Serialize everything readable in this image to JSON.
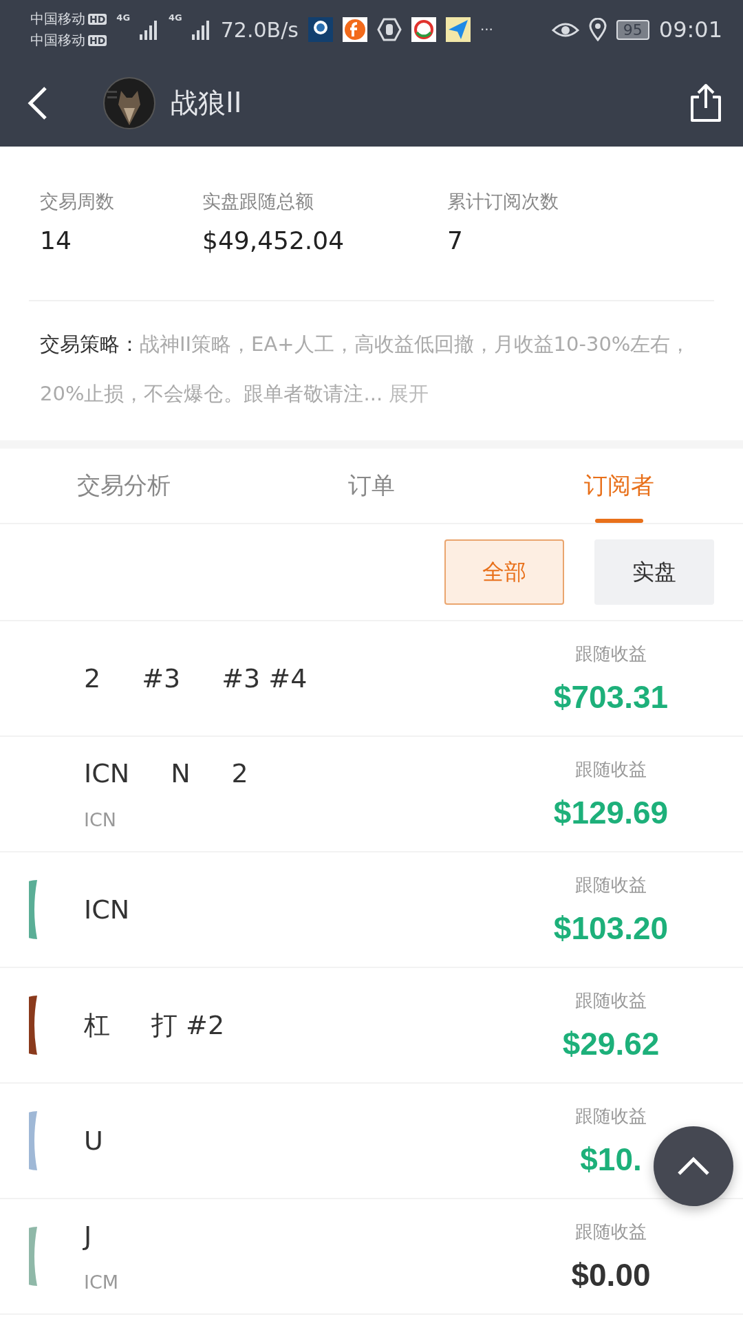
{
  "status_bar": {
    "carrier_1": "中国移动",
    "carrier_2": "中国移动",
    "hd_1": "HD",
    "hd_2": "HD",
    "net_1": "4G",
    "net_2": "4G",
    "speed": "72.0B/s",
    "more": "···",
    "battery": "95",
    "time": "09:01"
  },
  "header": {
    "title": "战狼II"
  },
  "stats": [
    {
      "label": "交易周数",
      "value": "14"
    },
    {
      "label": "实盘跟随总额",
      "value": "$49,452.04"
    },
    {
      "label": "累计订阅次数",
      "value": "7"
    }
  ],
  "strategy": {
    "label": "交易策略：",
    "text": "战神II策略，EA+人工，高收益低回撤，月收益10-30%左右，20%止损，不会爆仓。跟单者敬请注...",
    "expand": "展开"
  },
  "tabs": [
    {
      "label": "交易分析",
      "selected": false
    },
    {
      "label": "订单",
      "selected": false
    },
    {
      "label": "订阅者",
      "selected": true
    }
  ],
  "filters": [
    {
      "label": "全部",
      "selected": true
    },
    {
      "label": "实盘",
      "selected": false
    }
  ],
  "subscribers": [
    {
      "name_parts": [
        "2",
        "#3",
        "#3 #4"
      ],
      "profit_label": "跟随收益",
      "profit": "$703.31",
      "positive": true
    },
    {
      "name_parts": [
        "ICN",
        "N",
        "2"
      ],
      "sub_parts": [
        "ICN"
      ],
      "profit_label": "跟随收益",
      "profit": "$129.69",
      "positive": true
    },
    {
      "avatar": {
        "kind": "picture"
      },
      "name_parts": [
        "ICN"
      ],
      "profit_label": "跟随收益",
      "profit": "$103.20",
      "positive": true
    },
    {
      "avatar": {
        "kind": "picture"
      },
      "name_parts": [
        "杠",
        "打 #2"
      ],
      "profit_label": "跟随收益",
      "profit": "$29.62",
      "positive": true
    },
    {
      "avatar": {
        "kind": "picture"
      },
      "name_parts": [
        "U"
      ],
      "profit_label": "跟随收益",
      "profit": "$10.",
      "positive": true
    },
    {
      "avatar": {
        "kind": "picture"
      },
      "name_parts": [
        "J"
      ],
      "sub_parts": [
        "ICM"
      ],
      "profit_label": "跟随收益",
      "profit": "$0.00",
      "positive": false
    }
  ]
}
